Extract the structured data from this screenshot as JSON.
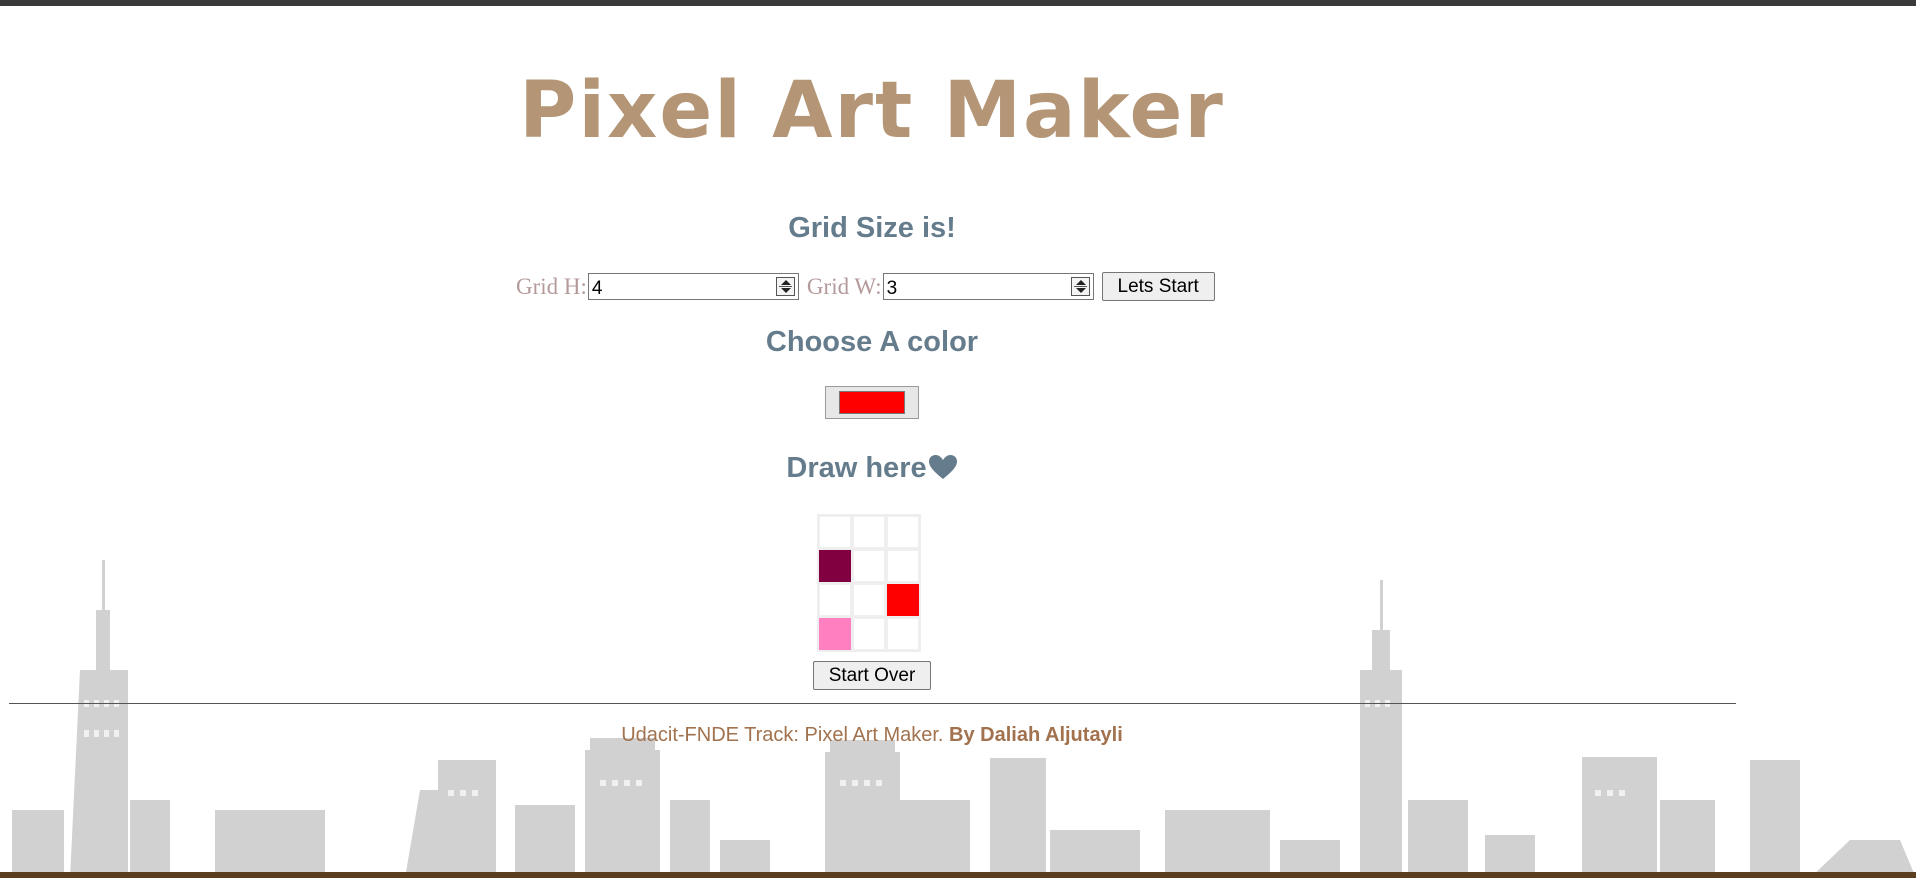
{
  "header": {
    "title": "Pixel Art Maker"
  },
  "grid_size": {
    "heading": "Grid Size is!",
    "height_label": "Grid H:",
    "height_value": "4",
    "width_label": "Grid W:",
    "width_value": "3",
    "submit_label": "Lets Start"
  },
  "color": {
    "heading": "Choose A color",
    "selected": "#ff0000"
  },
  "canvas": {
    "heading": "Draw here",
    "heading_icon": "heart-icon",
    "rows": [
      [
        "",
        "",
        ""
      ],
      [
        "#800040",
        "",
        ""
      ],
      [
        "",
        "",
        "#ff0000"
      ],
      [
        "#ff80c0",
        "",
        ""
      ]
    ],
    "reset_label": "Start Over"
  },
  "footer": {
    "text": "Udacit-FNDE Track: Pixel Art Maker. ",
    "author": "By Daliah Aljutayli"
  },
  "colors": {
    "title": "#b49677",
    "heading": "#657c8c",
    "footer": "#a1724d"
  }
}
